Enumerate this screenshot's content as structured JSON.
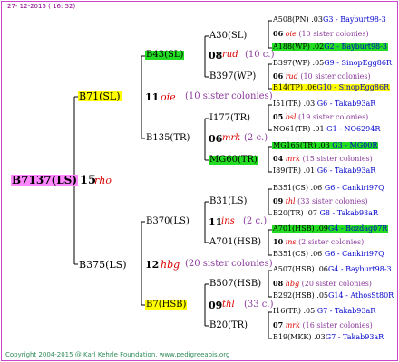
{
  "header": {
    "date": "27- 12-2015 ( 16: 52)"
  },
  "footer": {
    "copyright": "Copyright 2004-2015 @ Karl Kehrle Foundation.   www.pedigreeapis.org"
  },
  "root": {
    "id": "B7137(LS)",
    "gen": "15",
    "sp": "rho"
  },
  "g1": {
    "upper": {
      "id": "B71(SL)",
      "gen": "11",
      "sp": "oie",
      "sis": "(10 sister colonies)"
    },
    "lower": {
      "id": "B375(LS)",
      "gen": "12",
      "sp": "hbg",
      "sis": "(20 sister colonies)"
    }
  },
  "g2": {
    "a": {
      "id": "B43(SL)",
      "gen": "08",
      "sp": "rud",
      "sis": "(10 c.)"
    },
    "b": {
      "id": "B135(TR)",
      "gen": "06",
      "sp": "mrk",
      "sis": "(2 c.)"
    },
    "c": {
      "id": "B370(LS)",
      "gen": "11",
      "sp": "ins",
      "sis": "(2 c.)"
    },
    "d": {
      "id": "B7(HSB)",
      "gen": "09",
      "sp": "thl",
      "sis": "(33 c.)"
    }
  },
  "g3": {
    "a1": {
      "id": "A30(SL)"
    },
    "a2": {
      "id": "B397(WP)"
    },
    "b1": {
      "id": "I177(TR)"
    },
    "b2": {
      "id": "MG60(TR)"
    },
    "c1": {
      "id": "B31(LS)"
    },
    "c2": {
      "id": "A701(HSB)"
    },
    "d1": {
      "id": "B507(HSB)",
      "gen": "08",
      "sp": "hbg"
    },
    "d2": {
      "id": "B20(TR)",
      "gen": "07",
      "sp": "mrk"
    }
  },
  "g4": [
    {
      "id": "A508(PN)",
      "info": ".03",
      "loc": "G3 - Bayburt98-3"
    },
    {
      "gen": "06",
      "sp": "oie",
      "sis": "(10 sister colonies)"
    },
    {
      "id": "A188(WP)",
      "info": ".02",
      "loc": "G2 - Bayburt98-3"
    },
    {
      "id": "B397(WP)",
      "info": ".05",
      "loc": "G9 - SinopEgg86R"
    },
    {
      "gen": "06",
      "sp": "rud",
      "sis": "(10 sister colonies)"
    },
    {
      "id": "B14(TP)",
      "info": ".06",
      "loc": "G10 - SinopEgg86R"
    },
    {
      "id": "I51(TR)",
      "info": ".03",
      "loc": "G6 - Takab93aR"
    },
    {
      "gen": "05",
      "sp": "bsl",
      "sis": "(19 sister colonies)"
    },
    {
      "id": "NO61(TR)",
      "info": ".01",
      "loc": "G1 - NO6294R"
    },
    {
      "id": "MG165(TR)",
      "info": ".03",
      "loc": "G3 - MG00R"
    },
    {
      "gen": "04",
      "sp": "mrk",
      "sis": "(15 sister colonies)"
    },
    {
      "id": "I89(TR)",
      "info": ".01",
      "loc": "G6 - Takab93aR"
    },
    {
      "id": "B351(CS)",
      "info": ".06",
      "loc": "G6 - Cankiri97Q"
    },
    {
      "gen": "09",
      "sp": "thl",
      "sis": "(33 sister colonies)"
    },
    {
      "id": "B20(TR)",
      "info": ".07",
      "loc": "G8 - Takab93aR"
    },
    {
      "id": "A701(HSB)",
      "info": ".09",
      "loc": "G4 - Bozdag07R"
    },
    {
      "gen": "10",
      "sp": "ins",
      "sis": "(2 sister colonies)"
    },
    {
      "id": "B351(CS)",
      "info": ".06",
      "loc": "G6 - Cankiri97Q"
    },
    {
      "id": "A507(HSB)",
      "info": ".06",
      "loc": "G4 - Bayburt98-3"
    },
    {
      "gen": "08",
      "sp": "hbg",
      "sis": "(20 sister colonies)"
    },
    {
      "id": "B292(HSB)",
      "info": ".05",
      "loc": "G14 - AthosSt80R"
    },
    {
      "id": "I16(TR)",
      "info": ".05",
      "loc": "G7 - Takab93aR"
    },
    {
      "gen": "07",
      "sp": "mrk",
      "sis": "(16 sister colonies)"
    },
    {
      "id": "B19(MKK)",
      "info": ".03",
      "loc": "G7 - Takab93aR"
    }
  ],
  "colors": {
    "frame": "#cc44cc",
    "yellow": "#ffff00",
    "green": "#22dd22",
    "root": "#ff88ff",
    "species": "#dd0000",
    "sister": "#8b3a9b",
    "location": "#0000cc"
  }
}
